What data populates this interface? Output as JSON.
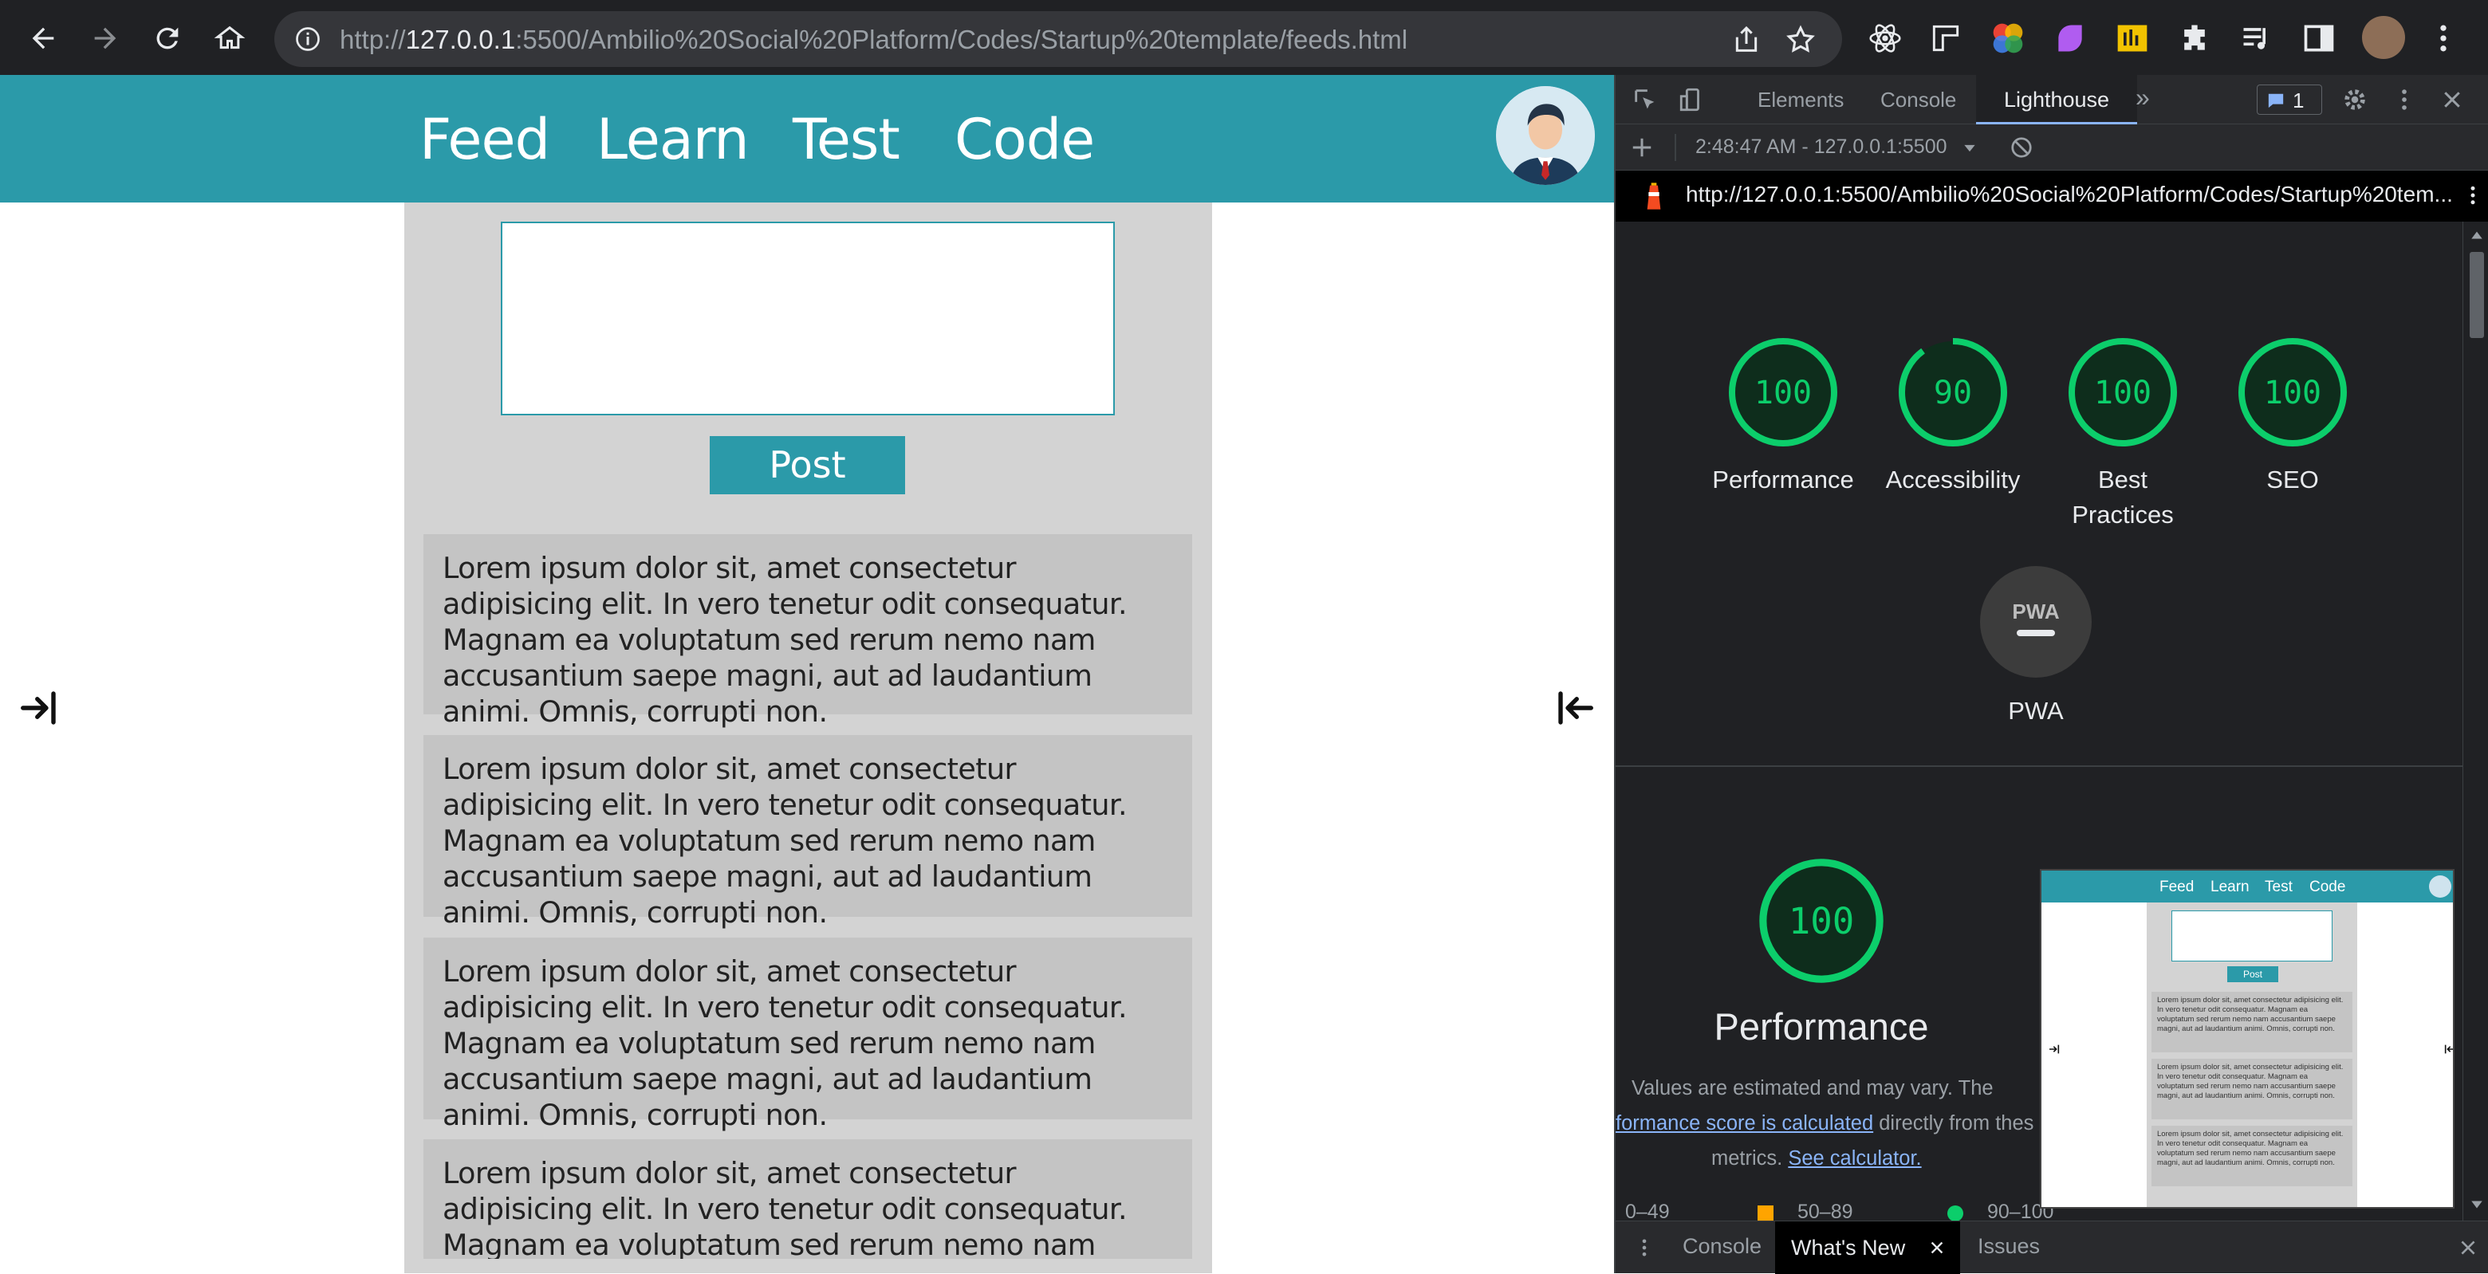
{
  "browser": {
    "url_host": "127.0.0.1",
    "url_rest": ":5500/Ambilio%20Social%20Platform/Codes/Startup%20template/feeds.html",
    "url_scheme": "http://"
  },
  "site": {
    "nav": [
      "Feed",
      "Learn",
      "Test",
      "Code"
    ],
    "post_button": "Post",
    "post_placeholder": "",
    "posts": [
      "Lorem ipsum dolor sit, amet consectetur adipisicing elit. In vero tenetur odit consequatur. Magnam ea voluptatum sed rerum nemo nam accusantium saepe magni, aut ad laudantium animi. Omnis, corrupti non.",
      "Lorem ipsum dolor sit, amet consectetur adipisicing elit. In vero tenetur odit consequatur. Magnam ea voluptatum sed rerum nemo nam accusantium saepe magni, aut ad laudantium animi. Omnis, corrupti non.",
      "Lorem ipsum dolor sit, amet consectetur adipisicing elit. In vero tenetur odit consequatur. Magnam ea voluptatum sed rerum nemo nam accusantium saepe magni, aut ad laudantium animi. Omnis, corrupti non.",
      "Lorem ipsum dolor sit, amet consectetur adipisicing elit. In vero tenetur odit consequatur. Magnam ea voluptatum sed rerum nemo nam accusantium saepe"
    ],
    "accent_color": "#2b9aa9"
  },
  "devtools": {
    "tabs": [
      "Elements",
      "Console",
      "Lighthouse"
    ],
    "active_tab": "Lighthouse",
    "more_tabs": "»",
    "issues_count": "1",
    "report_time": "2:48:47 AM - 127.0.0.1:5500",
    "report_url": "http://127.0.0.1:5500/Ambilio%20Social%20Platform/Codes/Startup%20tem...",
    "scores": [
      {
        "label": "Performance",
        "value": "100"
      },
      {
        "label": "Accessibility",
        "value": "90"
      },
      {
        "label": "Best Practices",
        "value": "100"
      },
      {
        "label": "SEO",
        "value": "100"
      }
    ],
    "pwa_label": "PWA",
    "pwa_badge": "PWA",
    "perf_score": "100",
    "perf_title": "Performance",
    "perf_desc_1": "Values are estimated and may vary. The",
    "perf_link_1": "formance score is calculated",
    "perf_desc_2": "directly from thes",
    "perf_desc_3": "metrics.",
    "perf_link_2": "See calculator.",
    "legend": [
      "0–49",
      "50–89",
      "90–100"
    ],
    "drawer_tabs": [
      "Console",
      "What's New",
      "Issues"
    ],
    "good_color": "#0cce6b",
    "avg_color": "#ffa400",
    "thumb_nav": [
      "Feed",
      "Learn",
      "Test",
      "Code"
    ],
    "thumb_post": "Post",
    "thumb_text": "Lorem ipsum dolor sit, amet consectetur adipisicing elit. In vero tenetur odit consequatur. Magnam ea voluptatum sed rerum nemo nam accusantium saepe magni, aut ad laudantium animi. Omnis, corrupti non."
  }
}
